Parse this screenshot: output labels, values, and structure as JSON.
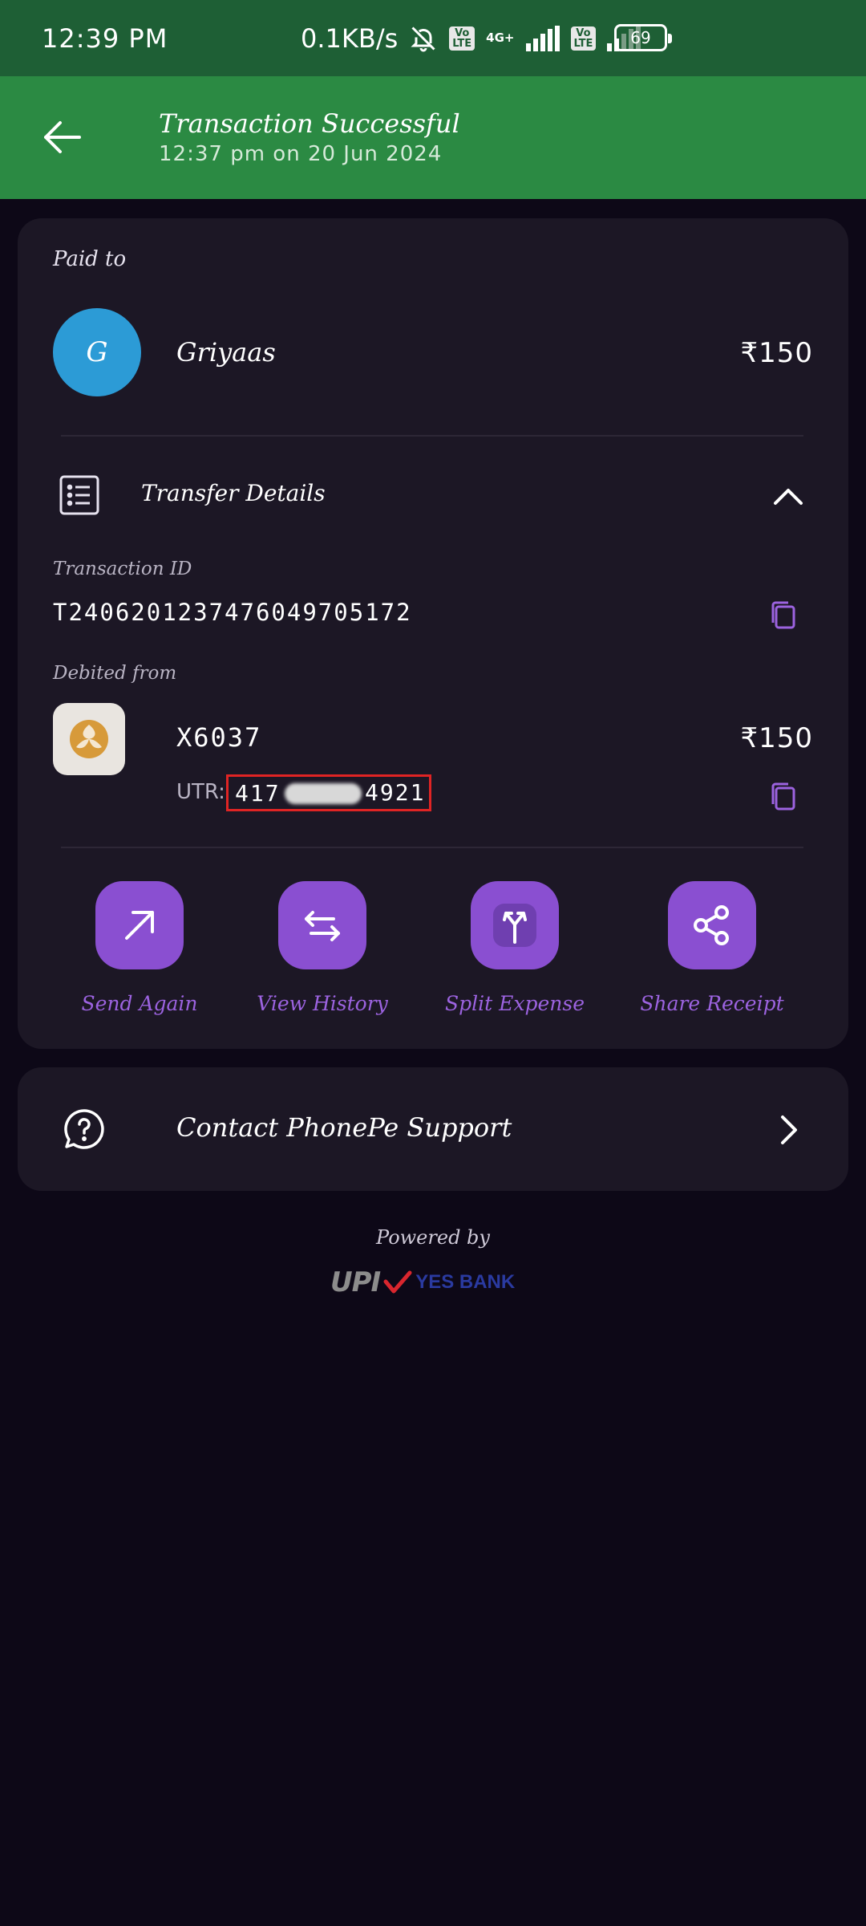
{
  "status_bar": {
    "time": "12:39 PM",
    "net_speed": "0.1KB/s",
    "volte": "Vo\nLTE",
    "network": "4G+",
    "battery": "69"
  },
  "header": {
    "title": "Transaction Successful",
    "subtitle": "12:37 pm on 20 Jun 2024"
  },
  "payment": {
    "paid_to_label": "Paid to",
    "avatar_letter": "G",
    "payee_name": "Griyaas",
    "amount": "₹150"
  },
  "transfer_details": {
    "label": "Transfer Details",
    "transaction_id_label": "Transaction ID",
    "transaction_id": "T2406201237476049705172",
    "debited_from_label": "Debited from",
    "account": "X6037",
    "amount": "₹150",
    "utr_label": "UTR:",
    "utr_start": "417",
    "utr_end": "4921"
  },
  "actions": [
    {
      "label": "Send Again",
      "icon": "arrow-up-right-icon"
    },
    {
      "label": "View History",
      "icon": "swap-arrows-icon"
    },
    {
      "label": "Split Expense",
      "icon": "split-icon"
    },
    {
      "label": "Share Receipt",
      "icon": "share-icon"
    }
  ],
  "support": {
    "label": "Contact PhonePe Support"
  },
  "footer": {
    "powered_by": "Powered by",
    "upi": "UPI",
    "bank": "YES BANK"
  },
  "colors": {
    "status_bar": "#1e5f35",
    "header": "#2b8a43",
    "background": "#0d0817",
    "card": "#1c1725",
    "accent": "#8a4fd1",
    "avatar": "#2c9bd6",
    "highlight": "#e02424"
  }
}
